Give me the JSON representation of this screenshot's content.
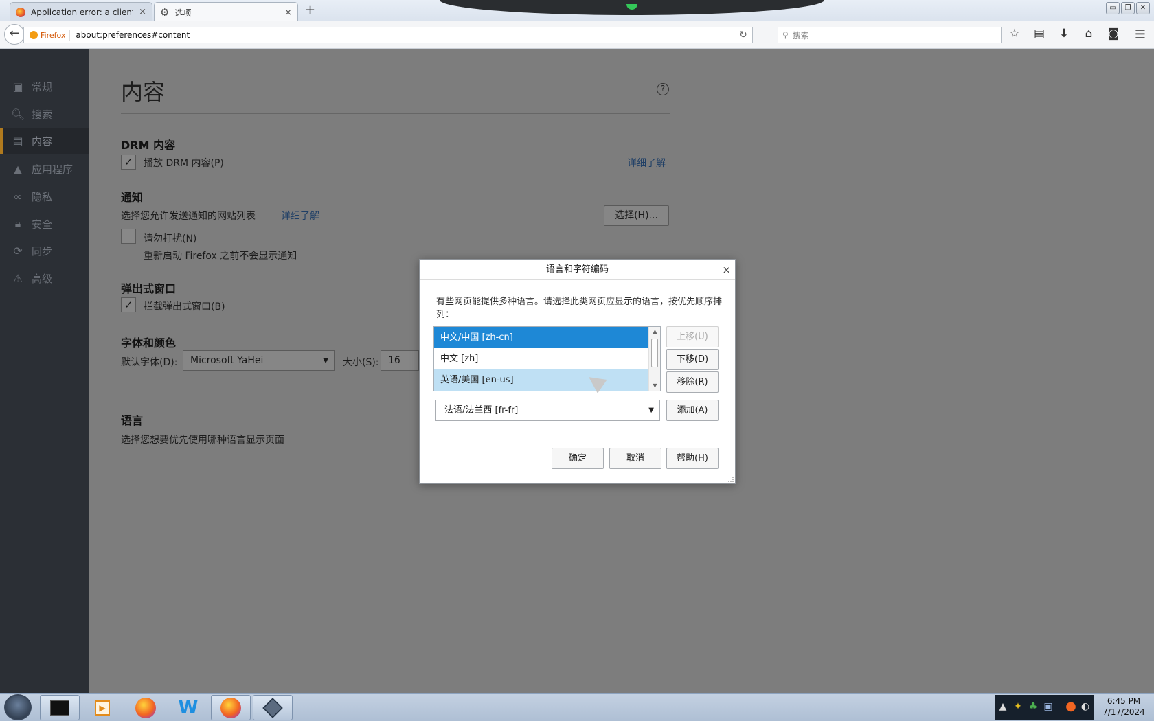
{
  "tabs": [
    {
      "label": "Application error: a client-s...",
      "close": "×"
    },
    {
      "label": "选项",
      "close": "×"
    }
  ],
  "newtab_label": "+",
  "window_controls": [
    "▭",
    "❐",
    "✕"
  ],
  "navbar": {
    "identity": "Firefox",
    "url": "about:preferences#content",
    "search_placeholder": "搜索"
  },
  "sidebar": {
    "items": [
      {
        "label": "常规",
        "icon": "general-icon"
      },
      {
        "label": "搜索",
        "icon": "search-icon"
      },
      {
        "label": "内容",
        "icon": "content-icon"
      },
      {
        "label": "应用程序",
        "icon": "applications-icon"
      },
      {
        "label": "隐私",
        "icon": "privacy-mask-icon"
      },
      {
        "label": "安全",
        "icon": "lock-icon"
      },
      {
        "label": "同步",
        "icon": "sync-icon"
      },
      {
        "label": "高级",
        "icon": "advanced-icon"
      }
    ],
    "selected_index": 2
  },
  "content": {
    "title": "内容",
    "help": "?",
    "drm": {
      "heading": "DRM 内容",
      "checkbox_label": "播放 DRM 内容(P)",
      "checked": true,
      "learn_more": "详细了解"
    },
    "notifications": {
      "heading": "通知",
      "description": "选择您允许发送通知的网站列表",
      "learn_more": "详细了解",
      "choose_button": "选择(H)...",
      "dnd_label": "请勿打扰(N)",
      "dnd_checked": false,
      "dnd_note": "重新启动 Firefox 之前不会显示通知"
    },
    "popups": {
      "heading": "弹出式窗口",
      "checkbox_label": "拦截弹出式窗口(B)",
      "checked": true
    },
    "fonts": {
      "heading": "字体和颜色",
      "default_font_label": "默认字体(D):",
      "default_font_value": "Microsoft YaHei",
      "size_label": "大小(S):",
      "size_value": "16"
    },
    "languages": {
      "heading": "语言",
      "description": "选择您想要优先使用哪种语言显示页面"
    }
  },
  "dialog": {
    "title": "语言和字符编码",
    "close": "×",
    "description": "有些网页能提供多种语言。请选择此类网页应显示的语言，按优先顺序排列：",
    "languages": [
      {
        "label": "中文/中国  [zh-cn]",
        "state": "selected"
      },
      {
        "label": "中文  [zh]",
        "state": "normal"
      },
      {
        "label": "英语/美国  [en-us]",
        "state": "hover"
      }
    ],
    "move_up": "上移(U)",
    "move_down": "下移(D)",
    "remove": "移除(R)",
    "add_select_value": "法语/法兰西  [fr-fr]",
    "add": "添加(A)",
    "ok": "确定",
    "cancel": "取消",
    "help": "帮助(H)"
  },
  "taskbar": {
    "apps": [
      "start-orb-icon",
      "terminal-icon",
      "media-player-icon",
      "firefox-icon",
      "wps-writer-icon",
      "firefox-icon",
      "virtualbox-icon"
    ],
    "clock_time": "6:45 PM",
    "clock_date": "7/17/2024"
  }
}
